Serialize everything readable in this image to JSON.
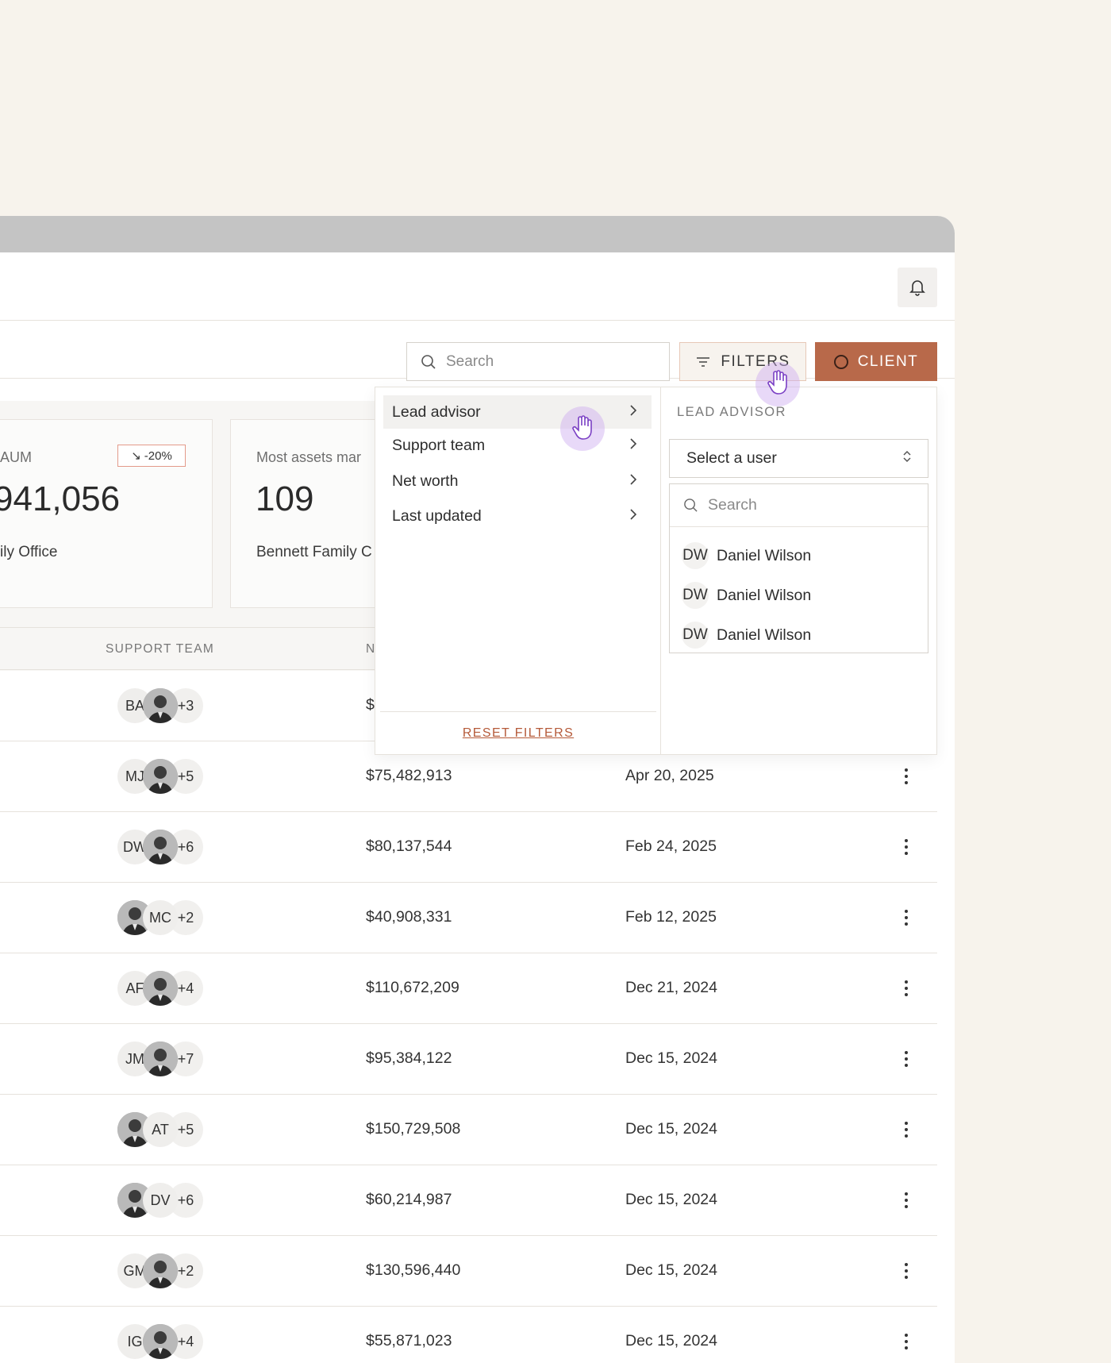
{
  "toolbar": {
    "search_placeholder": "Search",
    "filters_label": "FILTERS",
    "client_label": "CLIENT"
  },
  "cards": [
    {
      "label": "AUM",
      "trend": "-20%",
      "value": "941,056",
      "sub": "ily Office"
    },
    {
      "label": "Most assets mar",
      "value": "109",
      "sub": "Bennett Family C"
    }
  ],
  "table": {
    "headers": {
      "support_team": "SUPPORT TEAM",
      "net": "N"
    },
    "rows": [
      {
        "avatars": [
          {
            "type": "initials",
            "text": "BA"
          },
          {
            "type": "photo",
            "icon": "person-photo"
          },
          {
            "type": "more",
            "text": "+3"
          }
        ],
        "net": "$",
        "date": ""
      },
      {
        "avatars": [
          {
            "type": "initials",
            "text": "MJ"
          },
          {
            "type": "photo",
            "icon": "person-photo"
          },
          {
            "type": "more",
            "text": "+5"
          }
        ],
        "net": "$75,482,913",
        "date": "Apr 20, 2025"
      },
      {
        "avatars": [
          {
            "type": "initials",
            "text": "DW"
          },
          {
            "type": "photo",
            "icon": "person-photo"
          },
          {
            "type": "more",
            "text": "+6"
          }
        ],
        "net": "$80,137,544",
        "date": "Feb 24, 2025"
      },
      {
        "avatars": [
          {
            "type": "photo",
            "icon": "person-photo"
          },
          {
            "type": "initials",
            "text": "MC"
          },
          {
            "type": "more",
            "text": "+2"
          }
        ],
        "net": "$40,908,331",
        "date": "Feb 12, 2025"
      },
      {
        "avatars": [
          {
            "type": "initials",
            "text": "AF"
          },
          {
            "type": "photo",
            "icon": "person-photo"
          },
          {
            "type": "more",
            "text": "+4"
          }
        ],
        "net": "$110,672,209",
        "date": "Dec 21, 2024"
      },
      {
        "avatars": [
          {
            "type": "initials",
            "text": "JM"
          },
          {
            "type": "photo",
            "icon": "person-photo"
          },
          {
            "type": "more",
            "text": "+7"
          }
        ],
        "net": "$95,384,122",
        "date": "Dec 15, 2024"
      },
      {
        "avatars": [
          {
            "type": "photo",
            "icon": "person-photo"
          },
          {
            "type": "initials",
            "text": "AT"
          },
          {
            "type": "more",
            "text": "+5"
          }
        ],
        "net": "$150,729,508",
        "date": "Dec 15, 2024"
      },
      {
        "avatars": [
          {
            "type": "photo",
            "icon": "person-photo"
          },
          {
            "type": "initials",
            "text": "DV"
          },
          {
            "type": "more",
            "text": "+6"
          }
        ],
        "net": "$60,214,987",
        "date": "Dec 15, 2024"
      },
      {
        "avatars": [
          {
            "type": "initials",
            "text": "GM"
          },
          {
            "type": "photo",
            "icon": "person-photo"
          },
          {
            "type": "more",
            "text": "+2"
          }
        ],
        "net": "$130,596,440",
        "date": "Dec 15, 2024"
      },
      {
        "avatars": [
          {
            "type": "initials",
            "text": "IG"
          },
          {
            "type": "photo",
            "icon": "person-photo"
          },
          {
            "type": "more",
            "text": "+4"
          }
        ],
        "net": "$55,871,023",
        "date": "Dec 15, 2024"
      }
    ]
  },
  "filter_menu": {
    "items": [
      "Lead advisor",
      "Support team",
      "Net worth",
      "Last updated"
    ],
    "reset_label": "RESET FILTERS",
    "panel_label": "LEAD ADVISOR",
    "select_placeholder": "Select a user",
    "search_placeholder": "Search",
    "users": [
      {
        "initials": "DW",
        "name": "Daniel Wilson"
      },
      {
        "initials": "DW",
        "name": "Daniel Wilson"
      },
      {
        "initials": "DW",
        "name": "Daniel Wilson"
      }
    ]
  },
  "colors": {
    "accent": "#b8694a",
    "background": "#f7f3ec",
    "cursor_halo": "#cdaaf0"
  }
}
